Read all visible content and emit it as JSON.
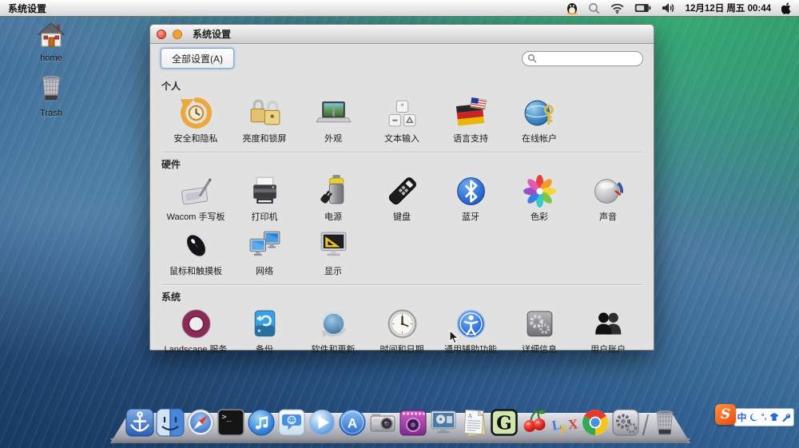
{
  "menubar": {
    "app_name": "系统设置",
    "clock": "12月12日 周五 00:44",
    "status_icons": [
      "tux-icon",
      "search-icon",
      "wifi-icon",
      "battery-icon",
      "volume-icon",
      "apple-icon"
    ]
  },
  "desktop": {
    "home_label": "home",
    "trash_label": "Trash"
  },
  "window": {
    "title": "系统设置",
    "toolbar": {
      "all_settings_button": "全部设置(A)",
      "search_value": "",
      "search_placeholder": ""
    },
    "sections": [
      {
        "header": "个人",
        "items": [
          {
            "label": "安全和隐私",
            "icon": "security-privacy-icon"
          },
          {
            "label": "亮度和锁屏",
            "icon": "brightness-lock-icon"
          },
          {
            "label": "外观",
            "icon": "appearance-icon"
          },
          {
            "label": "文本输入",
            "icon": "text-entry-icon"
          },
          {
            "label": "语言支持",
            "icon": "language-support-icon"
          },
          {
            "label": "在线帐户",
            "icon": "online-accounts-icon"
          }
        ]
      },
      {
        "header": "硬件",
        "items": [
          {
            "label": "Wacom 手写板",
            "icon": "wacom-tablet-icon"
          },
          {
            "label": "打印机",
            "icon": "printer-icon"
          },
          {
            "label": "电源",
            "icon": "power-icon"
          },
          {
            "label": "键盘",
            "icon": "keyboard-icon"
          },
          {
            "label": "蓝牙",
            "icon": "bluetooth-icon"
          },
          {
            "label": "色彩",
            "icon": "color-icon"
          },
          {
            "label": "声音",
            "icon": "sound-icon"
          },
          {
            "label": "鼠标和触摸板",
            "icon": "mouse-touchpad-icon"
          },
          {
            "label": "网络",
            "icon": "network-icon"
          },
          {
            "label": "显示",
            "icon": "displays-icon"
          }
        ]
      },
      {
        "header": "系统",
        "items": [
          {
            "label": "Landscape 服务",
            "icon": "landscape-service-icon"
          },
          {
            "label": "备份",
            "icon": "backup-icon"
          },
          {
            "label": "软件和更新",
            "icon": "software-updates-icon"
          },
          {
            "label": "时间和日期",
            "icon": "time-date-icon"
          },
          {
            "label": "通用辅助功能",
            "icon": "universal-access-icon"
          },
          {
            "label": "详细信息",
            "icon": "details-icon"
          },
          {
            "label": "用户账户",
            "icon": "user-accounts-icon"
          }
        ]
      }
    ]
  },
  "dock": {
    "items": [
      "docky-anchor",
      "finder",
      "safari",
      "terminal",
      "itunes",
      "messages",
      "media-player",
      "app-store",
      "camera",
      "photo-booth",
      "movie-player",
      "textedit",
      "g-editor",
      "cherry-app",
      "lyx",
      "chrome",
      "system-preferences",
      "trash"
    ]
  },
  "ime": {
    "logo": "S",
    "mode": "中",
    "punct": "°,",
    "buttons": [
      "chinese-mode",
      "fullwidth-moon-icon",
      "punctuation",
      "skin-shirt-icon",
      "settings-wrench-icon"
    ]
  }
}
